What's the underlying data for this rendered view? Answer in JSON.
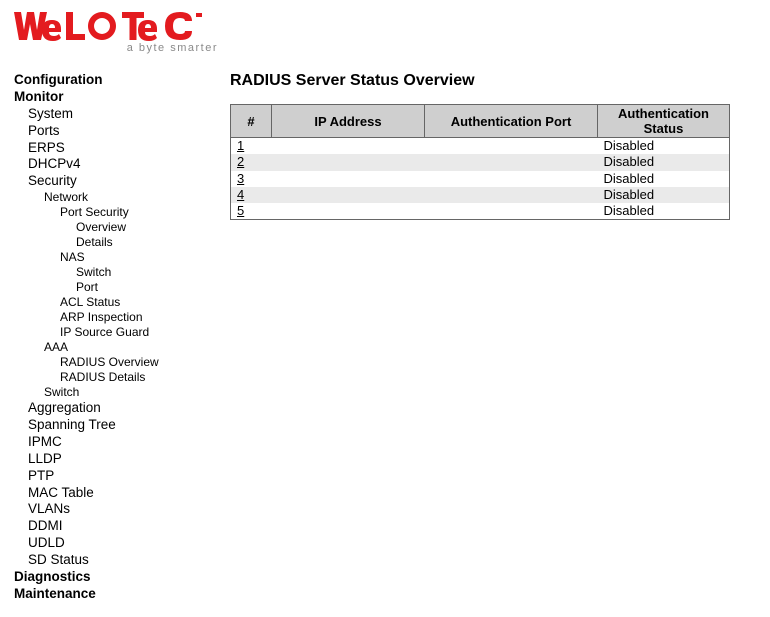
{
  "brand": {
    "name": "WELOTEC",
    "tagline": "a byte smarter",
    "accent_color": "#e31b1f"
  },
  "sidebar": {
    "configuration": "Configuration",
    "monitor": "Monitor",
    "system": "System",
    "ports": "Ports",
    "erps": "ERPS",
    "dhcpv4": "DHCPv4",
    "security": "Security",
    "network": "Network",
    "port_security": "Port Security",
    "overview": "Overview",
    "details": "Details",
    "nas": "NAS",
    "switch": "Switch",
    "port": "Port",
    "acl_status": "ACL Status",
    "arp_inspection": "ARP Inspection",
    "ip_source_guard": "IP Source Guard",
    "aaa": "AAA",
    "radius_overview": "RADIUS Overview",
    "radius_details": "RADIUS Details",
    "switch2": "Switch",
    "aggregation": "Aggregation",
    "spanning_tree": "Spanning Tree",
    "ipmc": "IPMC",
    "lldp": "LLDP",
    "ptp": "PTP",
    "mac_table": "MAC Table",
    "vlans": "VLANs",
    "ddmi": "DDMI",
    "udld": "UDLD",
    "sd_status": "SD Status",
    "diagnostics": "Diagnostics",
    "maintenance": "Maintenance"
  },
  "content": {
    "title": "RADIUS Server Status Overview",
    "columns": {
      "num": "#",
      "ip": "IP Address",
      "auth_port": "Authentication Port",
      "auth_status": "Authentication Status"
    },
    "rows": [
      {
        "num": "1",
        "ip": "",
        "auth_port": "",
        "auth_status": "Disabled"
      },
      {
        "num": "2",
        "ip": "",
        "auth_port": "",
        "auth_status": "Disabled"
      },
      {
        "num": "3",
        "ip": "",
        "auth_port": "",
        "auth_status": "Disabled"
      },
      {
        "num": "4",
        "ip": "",
        "auth_port": "",
        "auth_status": "Disabled"
      },
      {
        "num": "5",
        "ip": "",
        "auth_port": "",
        "auth_status": "Disabled"
      }
    ]
  }
}
